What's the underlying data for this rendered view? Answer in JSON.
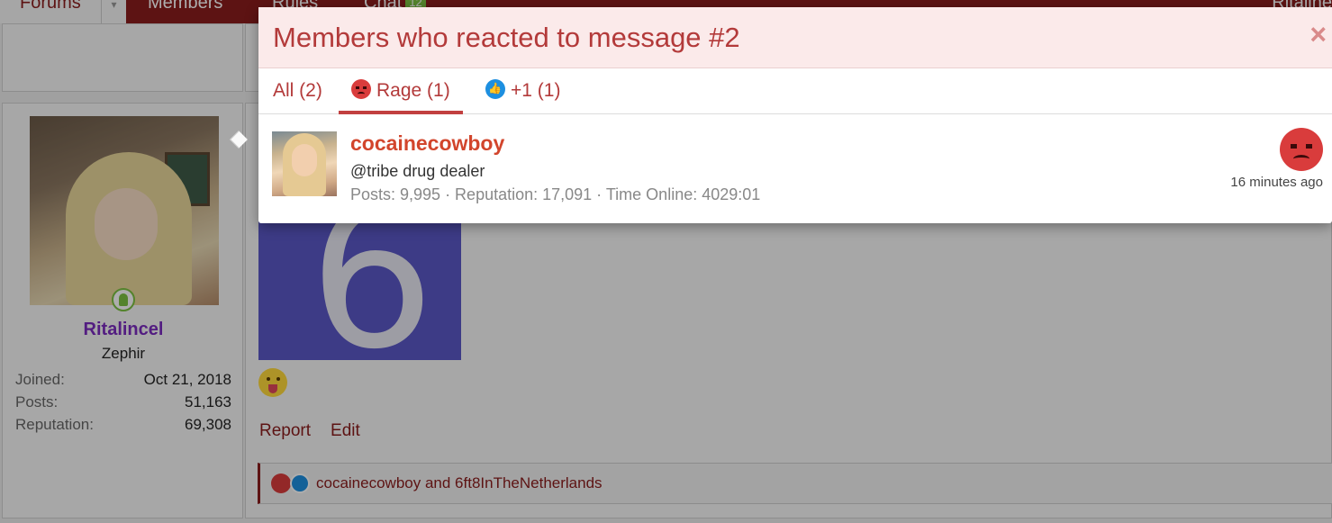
{
  "nav": {
    "forums": "Forums",
    "members": "Members",
    "rules": "Rules",
    "chat": "Chat",
    "chat_badge": "12",
    "user": "Ritaline"
  },
  "sidebar": {
    "username": "Ritalincel",
    "user_title": "Zephir",
    "stats": [
      {
        "label": "Joined:",
        "value": "Oct 21, 2018"
      },
      {
        "label": "Posts:",
        "value": "51,163"
      },
      {
        "label": "Reputation:",
        "value": "69,308"
      }
    ]
  },
  "post": {
    "image_text": "6",
    "actions": [
      "Report",
      "Edit"
    ],
    "reactions_summary": "cocainecowboy and 6ft8InTheNetherlands"
  },
  "modal": {
    "title": "Members who reacted to message #2",
    "close_icon": "×",
    "tabs": [
      {
        "label": "All (2)",
        "icon": null,
        "active": false
      },
      {
        "label": "Rage (1)",
        "icon": "rage-emoji-icon",
        "active": true
      },
      {
        "label": "+1 (1)",
        "icon": "thumbs-up-icon",
        "active": false
      }
    ],
    "members": [
      {
        "name": "cocainecowboy",
        "title": "@tribe drug dealer",
        "stats": "Posts: 9,995 · Reputation: 17,091 · Time Online: 4029:01",
        "reaction": "rage-emoji-icon",
        "time": "16 minutes ago"
      }
    ]
  },
  "colors": {
    "brand": "#8a1c1c",
    "accent": "#b33a3a",
    "username_highlight": "#d2452c",
    "rage": "#d93c3c",
    "like": "#1d8fe0"
  }
}
